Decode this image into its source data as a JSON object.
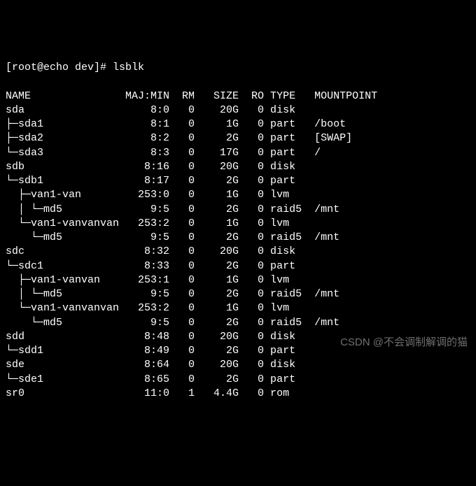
{
  "prompt": {
    "user_host": "[root@echo dev]#",
    "command": "lsblk"
  },
  "headers": {
    "name": "NAME",
    "majmin": "MAJ:MIN",
    "rm": "RM",
    "size": "SIZE",
    "ro": "RO",
    "type": "TYPE",
    "mountpoint": "MOUNTPOINT"
  },
  "rows": [
    {
      "tree": "sda",
      "maj": "8:0",
      "rm": "0",
      "size": "20G",
      "ro": "0",
      "type": "disk",
      "mount": ""
    },
    {
      "tree": "├─sda1",
      "maj": "8:1",
      "rm": "0",
      "size": "1G",
      "ro": "0",
      "type": "part",
      "mount": "/boot"
    },
    {
      "tree": "├─sda2",
      "maj": "8:2",
      "rm": "0",
      "size": "2G",
      "ro": "0",
      "type": "part",
      "mount": "[SWAP]"
    },
    {
      "tree": "└─sda3",
      "maj": "8:3",
      "rm": "0",
      "size": "17G",
      "ro": "0",
      "type": "part",
      "mount": "/"
    },
    {
      "tree": "sdb",
      "maj": "8:16",
      "rm": "0",
      "size": "20G",
      "ro": "0",
      "type": "disk",
      "mount": ""
    },
    {
      "tree": "└─sdb1",
      "maj": "8:17",
      "rm": "0",
      "size": "2G",
      "ro": "0",
      "type": "part",
      "mount": ""
    },
    {
      "tree": "  ├─van1-van",
      "maj": "253:0",
      "rm": "0",
      "size": "1G",
      "ro": "0",
      "type": "lvm",
      "mount": ""
    },
    {
      "tree": "  │ └─md5",
      "maj": "9:5",
      "rm": "0",
      "size": "2G",
      "ro": "0",
      "type": "raid5",
      "mount": "/mnt"
    },
    {
      "tree": "  └─van1-vanvanvan",
      "maj": "253:2",
      "rm": "0",
      "size": "1G",
      "ro": "0",
      "type": "lvm",
      "mount": ""
    },
    {
      "tree": "    └─md5",
      "maj": "9:5",
      "rm": "0",
      "size": "2G",
      "ro": "0",
      "type": "raid5",
      "mount": "/mnt"
    },
    {
      "tree": "sdc",
      "maj": "8:32",
      "rm": "0",
      "size": "20G",
      "ro": "0",
      "type": "disk",
      "mount": ""
    },
    {
      "tree": "└─sdc1",
      "maj": "8:33",
      "rm": "0",
      "size": "2G",
      "ro": "0",
      "type": "part",
      "mount": ""
    },
    {
      "tree": "  ├─van1-vanvan",
      "maj": "253:1",
      "rm": "0",
      "size": "1G",
      "ro": "0",
      "type": "lvm",
      "mount": ""
    },
    {
      "tree": "  │ └─md5",
      "maj": "9:5",
      "rm": "0",
      "size": "2G",
      "ro": "0",
      "type": "raid5",
      "mount": "/mnt"
    },
    {
      "tree": "  └─van1-vanvanvan",
      "maj": "253:2",
      "rm": "0",
      "size": "1G",
      "ro": "0",
      "type": "lvm",
      "mount": ""
    },
    {
      "tree": "    └─md5",
      "maj": "9:5",
      "rm": "0",
      "size": "2G",
      "ro": "0",
      "type": "raid5",
      "mount": "/mnt"
    },
    {
      "tree": "sdd",
      "maj": "8:48",
      "rm": "0",
      "size": "20G",
      "ro": "0",
      "type": "disk",
      "mount": ""
    },
    {
      "tree": "└─sdd1",
      "maj": "8:49",
      "rm": "0",
      "size": "2G",
      "ro": "0",
      "type": "part",
      "mount": ""
    },
    {
      "tree": "sde",
      "maj": "8:64",
      "rm": "0",
      "size": "20G",
      "ro": "0",
      "type": "disk",
      "mount": ""
    },
    {
      "tree": "└─sde1",
      "maj": "8:65",
      "rm": "0",
      "size": "2G",
      "ro": "0",
      "type": "part",
      "mount": ""
    },
    {
      "tree": "sr0",
      "maj": "11:0",
      "rm": "1",
      "size": "4.4G",
      "ro": "0",
      "type": "rom",
      "mount": ""
    }
  ],
  "watermark": "CSDN @不会调制解调的猫"
}
